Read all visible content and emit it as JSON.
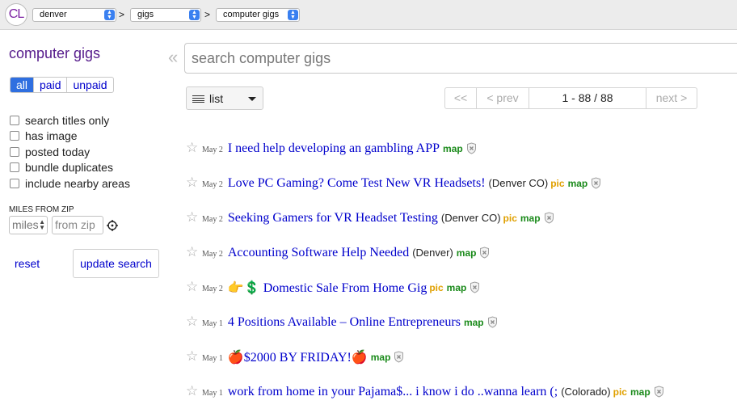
{
  "topbar": {
    "logo": "CL",
    "breadcrumbs": [
      {
        "value": "denver"
      },
      {
        "value": "gigs"
      },
      {
        "value": "computer gigs"
      }
    ],
    "separator": ">"
  },
  "sidebar": {
    "title": "computer gigs",
    "filters": [
      "all",
      "paid",
      "unpaid"
    ],
    "selected_filter": "all",
    "checkboxes": [
      {
        "label": "search titles only",
        "checked": false
      },
      {
        "label": "has image",
        "checked": false
      },
      {
        "label": "posted today",
        "checked": false
      },
      {
        "label": "bundle duplicates",
        "checked": false
      },
      {
        "label": "include nearby areas",
        "checked": false
      }
    ],
    "miles_label": "MILES FROM ZIP",
    "miles_placeholder": "miles",
    "zip_placeholder": "from zip",
    "reset_label": "reset",
    "update_label": "update search"
  },
  "main": {
    "collapse_glyph": "«",
    "search_placeholder": "search computer gigs",
    "view_mode": "list",
    "pager": {
      "first": "<<",
      "prev": "< prev",
      "range": "1 - 88 / 88",
      "next": "next >"
    },
    "listings": [
      {
        "date": "May 2",
        "title": "I need help developing an gambling APP",
        "location": "",
        "pic": "",
        "map": "map"
      },
      {
        "date": "May 2",
        "title": "Love PC Gaming? Come Test New VR Headsets!",
        "location": "(Denver CO)",
        "pic": "pic",
        "map": "map"
      },
      {
        "date": "May 2",
        "title": "Seeking Gamers for VR Headset Testing",
        "location": "(Denver CO)",
        "pic": "pic",
        "map": "map"
      },
      {
        "date": "May 2",
        "title": "Accounting Software Help Needed",
        "location": "(Denver)",
        "pic": "",
        "map": "map"
      },
      {
        "date": "May 2",
        "title": "👉💲 Domestic Sale From Home Gig",
        "location": "",
        "pic": "pic",
        "map": "map"
      },
      {
        "date": "May 1",
        "title": "4 Positions Available – Online Entrepreneurs",
        "location": "",
        "pic": "",
        "map": "map"
      },
      {
        "date": "May 1",
        "title": "🍎$2000 BY FRIDAY!🍎",
        "location": "",
        "pic": "",
        "map": "map"
      },
      {
        "date": "May 1",
        "title": "work from home in your Pajama$... i know i do ..wanna learn (;",
        "location": "(Colorado)",
        "pic": "pic",
        "map": "map"
      }
    ]
  },
  "colors": {
    "link": "#0000cc",
    "visited_title": "#551a8b",
    "pic_tag": "#e0a000",
    "map_tag": "#1a8a1a",
    "active_filter": "#2f6fe0"
  }
}
